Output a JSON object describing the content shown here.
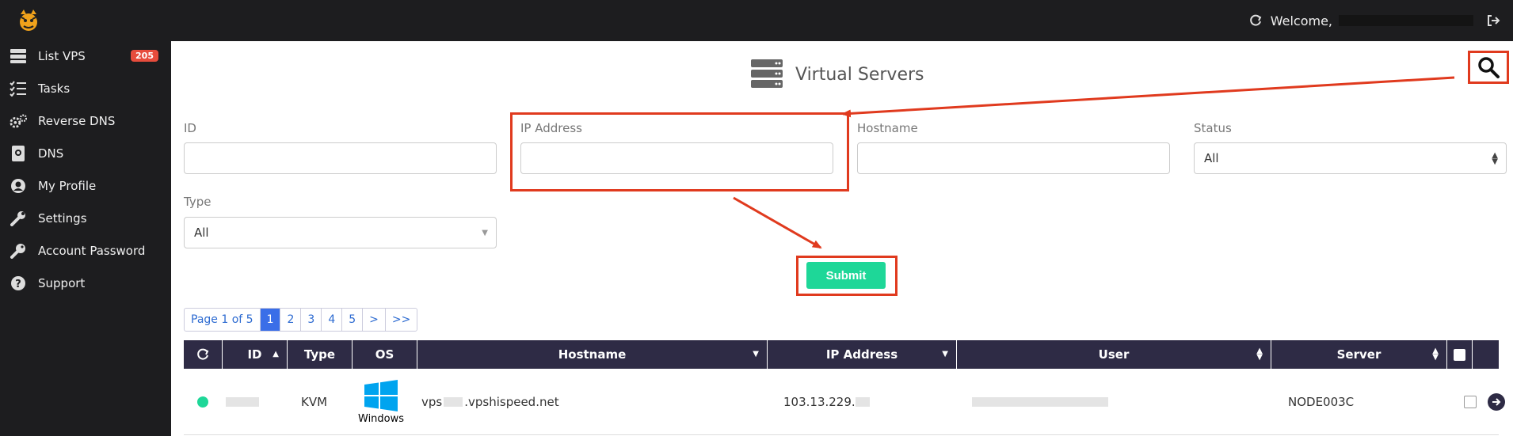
{
  "header": {
    "welcome_label": "Welcome,"
  },
  "sidebar": {
    "items": [
      {
        "label": "List VPS",
        "icon": "server-list-icon",
        "badge": "205"
      },
      {
        "label": "Tasks",
        "icon": "tasks-icon"
      },
      {
        "label": "Reverse DNS",
        "icon": "gears-icon"
      },
      {
        "label": "DNS",
        "icon": "dns-icon"
      },
      {
        "label": "My Profile",
        "icon": "user-icon"
      },
      {
        "label": "Settings",
        "icon": "wrench-icon"
      },
      {
        "label": "Account Password",
        "icon": "key-icon"
      },
      {
        "label": "Support",
        "icon": "question-icon"
      }
    ]
  },
  "page": {
    "title": "Virtual Servers"
  },
  "filters": {
    "id_label": "ID",
    "ip_label": "IP Address",
    "hostname_label": "Hostname",
    "status_label": "Status",
    "status_value": "All",
    "type_label": "Type",
    "type_value": "All",
    "submit_label": "Submit"
  },
  "pagination": {
    "summary": "Page 1 of 5",
    "pages": [
      "1",
      "2",
      "3",
      "4",
      "5"
    ],
    "next": ">",
    "last": ">>"
  },
  "table": {
    "columns": [
      "ID",
      "Type",
      "OS",
      "Hostname",
      "IP Address",
      "User",
      "Server"
    ],
    "rows": [
      {
        "type": "KVM",
        "os": "Windows",
        "hostname_prefix": "vps",
        "hostname_suffix": ".vpshispeed.net",
        "ip_prefix": "103.13.229.",
        "server": "NODE003C"
      }
    ]
  },
  "colors": {
    "annotation": "#e03a1e",
    "submit": "#1ed798",
    "table_header": "#2e2b45",
    "badge": "#e74c3c"
  }
}
